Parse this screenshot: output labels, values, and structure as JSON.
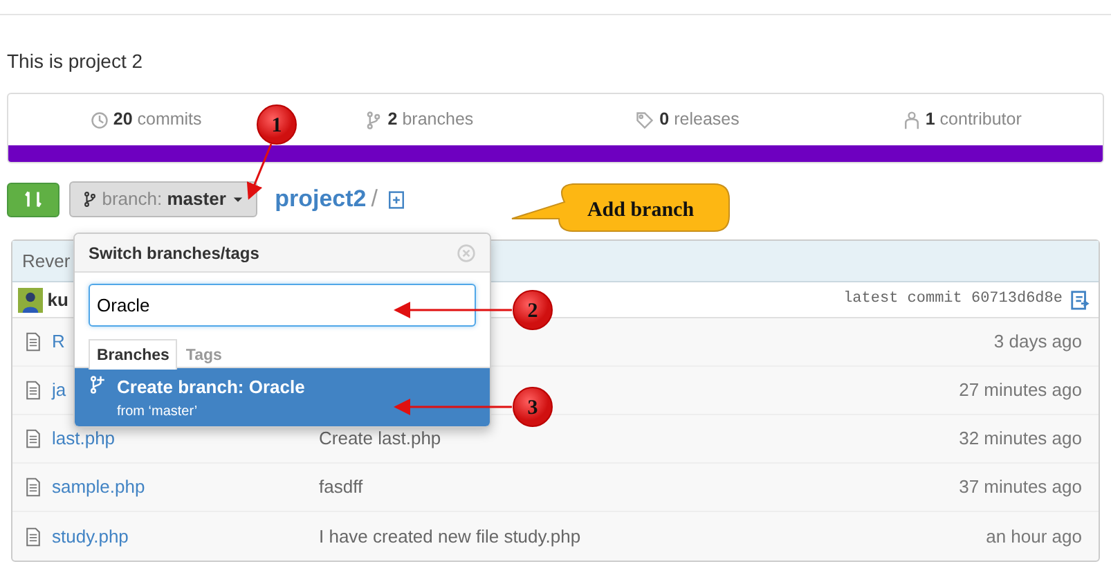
{
  "description": "This is project 2",
  "stats": [
    {
      "kind": "commits",
      "count": "20",
      "label": "commits"
    },
    {
      "kind": "branches",
      "count": "2",
      "label": "branches"
    },
    {
      "kind": "releases",
      "count": "0",
      "label": "releases"
    },
    {
      "kind": "contributors",
      "count": "1",
      "label": "contributor"
    }
  ],
  "toolbar": {
    "branch_prefix": "branch:",
    "branch_name": "master",
    "repo": "project2",
    "separator": "/"
  },
  "commit_bar": {
    "message": "Rever",
    "author": "ku",
    "latest_label": "latest commit",
    "sha": "60713d6d8e"
  },
  "files": [
    {
      "name": "R",
      "age": "3 days ago"
    },
    {
      "name": "ja",
      "age": "27 minutes ago"
    },
    {
      "name": "last.php",
      "message": "Create last.php",
      "age": "32 minutes ago"
    },
    {
      "name": "sample.php",
      "message": "fasdff",
      "age": "37 minutes ago"
    },
    {
      "name": "study.php",
      "message": "I have created new file study.php",
      "age": "an hour ago"
    }
  ],
  "branch_menu": {
    "title": "Switch branches/tags",
    "search_value": "Oracle",
    "tabs": [
      {
        "label": "Branches",
        "selected": true
      },
      {
        "label": "Tags",
        "selected": false
      }
    ],
    "items": [
      {
        "title": "Create branch: Oracle",
        "subtitle": "from ‘master’",
        "selected": true
      }
    ]
  },
  "annotations": [
    {
      "number": "1"
    },
    {
      "number": "2"
    },
    {
      "number": "3"
    }
  ],
  "callout": "Add branch"
}
